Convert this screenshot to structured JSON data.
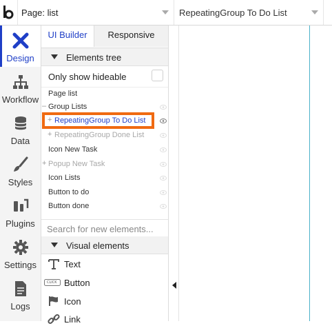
{
  "topbar": {
    "page_selector_value": "Page: list",
    "element_selector_value": "RepeatingGroup To Do List"
  },
  "nav": {
    "items": [
      {
        "label": "Design",
        "icon": "design-icon",
        "active": true
      },
      {
        "label": "Workflow",
        "icon": "workflow-icon"
      },
      {
        "label": "Data",
        "icon": "data-icon"
      },
      {
        "label": "Styles",
        "icon": "styles-icon"
      },
      {
        "label": "Plugins",
        "icon": "plugins-icon"
      },
      {
        "label": "Settings",
        "icon": "settings-icon"
      },
      {
        "label": "Logs",
        "icon": "logs-icon"
      }
    ]
  },
  "panel": {
    "tabs": [
      "UI Builder",
      "Responsive"
    ],
    "elements_tree_title": "Elements tree",
    "only_show_hideable_label": "Only show hideable",
    "tree": [
      {
        "label": "Page list",
        "prefix": ""
      },
      {
        "label": "Group Lists",
        "prefix": "–"
      },
      {
        "label": "RepeatingGroup To Do List",
        "prefix": "+"
      },
      {
        "label": "RepeatingGroup Done List",
        "prefix": "+"
      },
      {
        "label": "Icon New Task",
        "prefix": ""
      },
      {
        "label": "Popup New Task",
        "prefix": "+"
      },
      {
        "label": "Icon Lists",
        "prefix": ""
      },
      {
        "label": "Button to do",
        "prefix": ""
      },
      {
        "label": "Button done",
        "prefix": ""
      }
    ],
    "search_placeholder": "Search for new elements...",
    "visual_elements_title": "Visual elements",
    "visual_elements": [
      {
        "label": "Text",
        "icon": "text-icon"
      },
      {
        "label": "Button",
        "icon": "button-icon",
        "badge": "CLICK"
      },
      {
        "label": "Icon",
        "icon": "flag-icon"
      },
      {
        "label": "Link",
        "icon": "link-icon"
      }
    ]
  },
  "colors": {
    "accent": "#1f3fc7",
    "highlight": "#f06a11",
    "canvas_guide": "#4ab1c9"
  }
}
